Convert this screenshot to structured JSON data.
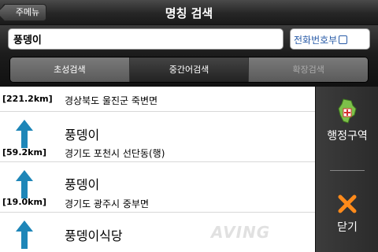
{
  "header": {
    "back_label": "주메뉴",
    "title": "명칭 검색"
  },
  "search": {
    "value": "풍뎅이",
    "phone_toggle_label": "전화번호부"
  },
  "tabs": [
    {
      "label": "초성검색",
      "state": "normal"
    },
    {
      "label": "중간어검색",
      "state": "active"
    },
    {
      "label": "확장검색",
      "state": "disabled"
    }
  ],
  "results": [
    {
      "distance": "[221.2km]",
      "name": "",
      "address": "경상북도 울진군 죽변면"
    },
    {
      "distance": "[59.2km]",
      "name": "풍뎅이",
      "address": "경기도 포천시 선단동(행)"
    },
    {
      "distance": "[19.0km]",
      "name": "풍뎅이",
      "address": "경기도 광주시 중부면"
    },
    {
      "distance": "",
      "name": "풍뎅이식당",
      "address": ""
    }
  ],
  "side": {
    "region_label": "행정구역",
    "close_label": "닫기"
  },
  "watermark": "AVING",
  "colors": {
    "arrow": "#1e86b8",
    "phone_text": "#2a5ca8",
    "close_x": "#ff8a1a",
    "region_icon": "#7dc04a"
  }
}
